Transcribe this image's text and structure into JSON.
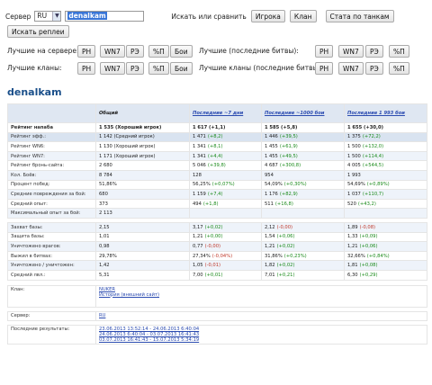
{
  "search": {
    "server_label": "Сервер",
    "server_value": "RU",
    "player_value": "denalkam",
    "find_label": "Искать или сравнить",
    "player_button": "Игрока",
    "clan_button": "Клан",
    "tank_stats_button": "Стата по танкам",
    "replays_button": "Искать реплеи"
  },
  "filters": {
    "best_server_label": "Лучшие на сервере:",
    "best_recent_label": "Лучшие (последние битвы):",
    "best_clans_label": "Лучшие кланы:",
    "best_clans_recent_label": "Лучшие кланы (последние битвы):",
    "row1_buttons": [
      "РН",
      "WN7",
      "РЭ",
      "%П",
      "Бои"
    ],
    "row1_right_buttons": [
      "РН",
      "WN7",
      "РЭ",
      "%П"
    ],
    "row2_buttons": [
      "РН",
      "WN7",
      "РЭ",
      "%П",
      "Бои"
    ],
    "row2_right_buttons": [
      "РН",
      "WN7",
      "РЭ",
      "%П"
    ]
  },
  "player": {
    "name": "denalkam"
  },
  "table": {
    "headers": [
      "",
      "Общий",
      "Последние ~7 дни",
      "Последние ~1000 бои",
      "Последние 1 993 бои"
    ],
    "rows": [
      {
        "label": "Рейтинг напаба",
        "cells": [
          [
            "1 535 (Хороший игрок)",
            ""
          ],
          [
            "1 617 (+1,1)",
            ""
          ],
          [
            "1 585 (+5,8)",
            ""
          ],
          [
            "1 655 (+30,0)",
            ""
          ]
        ],
        "bold": true
      },
      {
        "label": "Рейтинг эфф.:",
        "cells": [
          [
            "1 142 (Средний игрок)",
            ""
          ],
          [
            "1 471",
            "(+8,2)"
          ],
          [
            "1 446",
            "(+39,5)"
          ],
          [
            "1 375",
            "(+72,2)"
          ]
        ],
        "hl": true
      },
      {
        "label": "Рейтинг WN6:",
        "cells": [
          [
            "1 130 (Хороший игрок)",
            ""
          ],
          [
            "1 341",
            "(+8,1)"
          ],
          [
            "1 455",
            "(+61,9)"
          ],
          [
            "1 500",
            "(+132,0)"
          ]
        ]
      },
      {
        "label": "Рейтинг WN7:",
        "cells": [
          [
            "1 171 (Хороший игрок)",
            ""
          ],
          [
            "1 341",
            "(+4,4)"
          ],
          [
            "1 455",
            "(+49,5)"
          ],
          [
            "1 500",
            "(+114,4)"
          ]
        ]
      },
      {
        "label": "Рейтинг бронь-сайта:",
        "cells": [
          [
            "2 680",
            ""
          ],
          [
            "5 046",
            "(+39,8)"
          ],
          [
            "4 687",
            "(+300,8)"
          ],
          [
            "4 005",
            "(+544,5)"
          ]
        ]
      },
      {
        "label": "Кол. Боёв:",
        "cells": [
          [
            "8 784",
            ""
          ],
          [
            "128",
            ""
          ],
          [
            "954",
            ""
          ],
          [
            "1 993",
            ""
          ]
        ]
      },
      {
        "label": "Процент побед:",
        "cells": [
          [
            "51,86%",
            ""
          ],
          [
            "56,25%",
            "(+0,07%)"
          ],
          [
            "54,09%",
            "(+0,30%)"
          ],
          [
            "54,69%",
            "(+0,89%)"
          ]
        ]
      },
      {
        "label": "Средние повреждения за бой:",
        "cells": [
          [
            "680",
            ""
          ],
          [
            "1 159",
            "(+7,4)"
          ],
          [
            "1 176",
            "(+82,9)"
          ],
          [
            "1 037",
            "(+110,7)"
          ]
        ]
      },
      {
        "label": "Средний опыт:",
        "cells": [
          [
            "373",
            ""
          ],
          [
            "494",
            "(+1,8)"
          ],
          [
            "511",
            "(+16,8)"
          ],
          [
            "520",
            "(+43,2)"
          ]
        ]
      },
      {
        "label": "Максимальный опыт за бой:",
        "cells": [
          [
            "2 113",
            ""
          ],
          [
            "",
            ""
          ],
          [
            "",
            ""
          ],
          [
            "",
            ""
          ]
        ]
      },
      {
        "label": "",
        "cells": [
          [
            "",
            ""
          ],
          [
            "",
            ""
          ],
          [
            "",
            ""
          ],
          [
            "",
            ""
          ]
        ],
        "sep": true
      },
      {
        "label": "Захват базы:",
        "cells": [
          [
            "2,15",
            ""
          ],
          [
            "3,17",
            "(+0,02)"
          ],
          [
            "2,12",
            "(-0,00)"
          ],
          [
            "1,89",
            "(-0,08)"
          ]
        ]
      },
      {
        "label": "Защита базы:",
        "cells": [
          [
            "1,01",
            ""
          ],
          [
            "1,21",
            "(+0,00)"
          ],
          [
            "1,54",
            "(+0,06)"
          ],
          [
            "1,33",
            "(+0,09)"
          ]
        ]
      },
      {
        "label": "Уничтожено врагов:",
        "cells": [
          [
            "0,98",
            ""
          ],
          [
            "0,77",
            "(-0,00)"
          ],
          [
            "1,21",
            "(+0,02)"
          ],
          [
            "1,21",
            "(+0,06)"
          ]
        ]
      },
      {
        "label": "Выжил в битвах:",
        "cells": [
          [
            "29,78%",
            ""
          ],
          [
            "27,34%",
            "(-0,04%)"
          ],
          [
            "31,86%",
            "(+0,23%)"
          ],
          [
            "32,66%",
            "(+0,84%)"
          ]
        ]
      },
      {
        "label": "Уничтожено / уничтожен:",
        "cells": [
          [
            "1,42",
            ""
          ],
          [
            "1,05",
            "(-0,01)"
          ],
          [
            "1,82",
            "(+0,02)"
          ],
          [
            "1,81",
            "(+0,08)"
          ]
        ]
      },
      {
        "label": "Средний лвл.:",
        "cells": [
          [
            "5,31",
            ""
          ],
          [
            "7,00",
            "(+0,01)"
          ],
          [
            "7,01",
            "(+0,21)"
          ],
          [
            "6,30",
            "(+0,29)"
          ]
        ]
      }
    ],
    "clan_label": "Клан:",
    "clan_name": "NUKER",
    "clan_history": "История (внешний сайт)",
    "server_label": "Сервер:",
    "server_value": "RU",
    "recent_label": "Последние результаты:",
    "recent_links": [
      "23.06.2013 13:52:14 - 24.06.2013 6:40:04",
      "24.06.2013 6:40:04 - 03.07.2013 16:41:43",
      "03.07.2013 16:41:43 - 15.07.2013 5:34:19"
    ]
  },
  "colors": {
    "positive": "#1a8a1a",
    "negative": "#c0392b",
    "link": "#2b4bb0",
    "header_bg": "#dfe7f2"
  }
}
